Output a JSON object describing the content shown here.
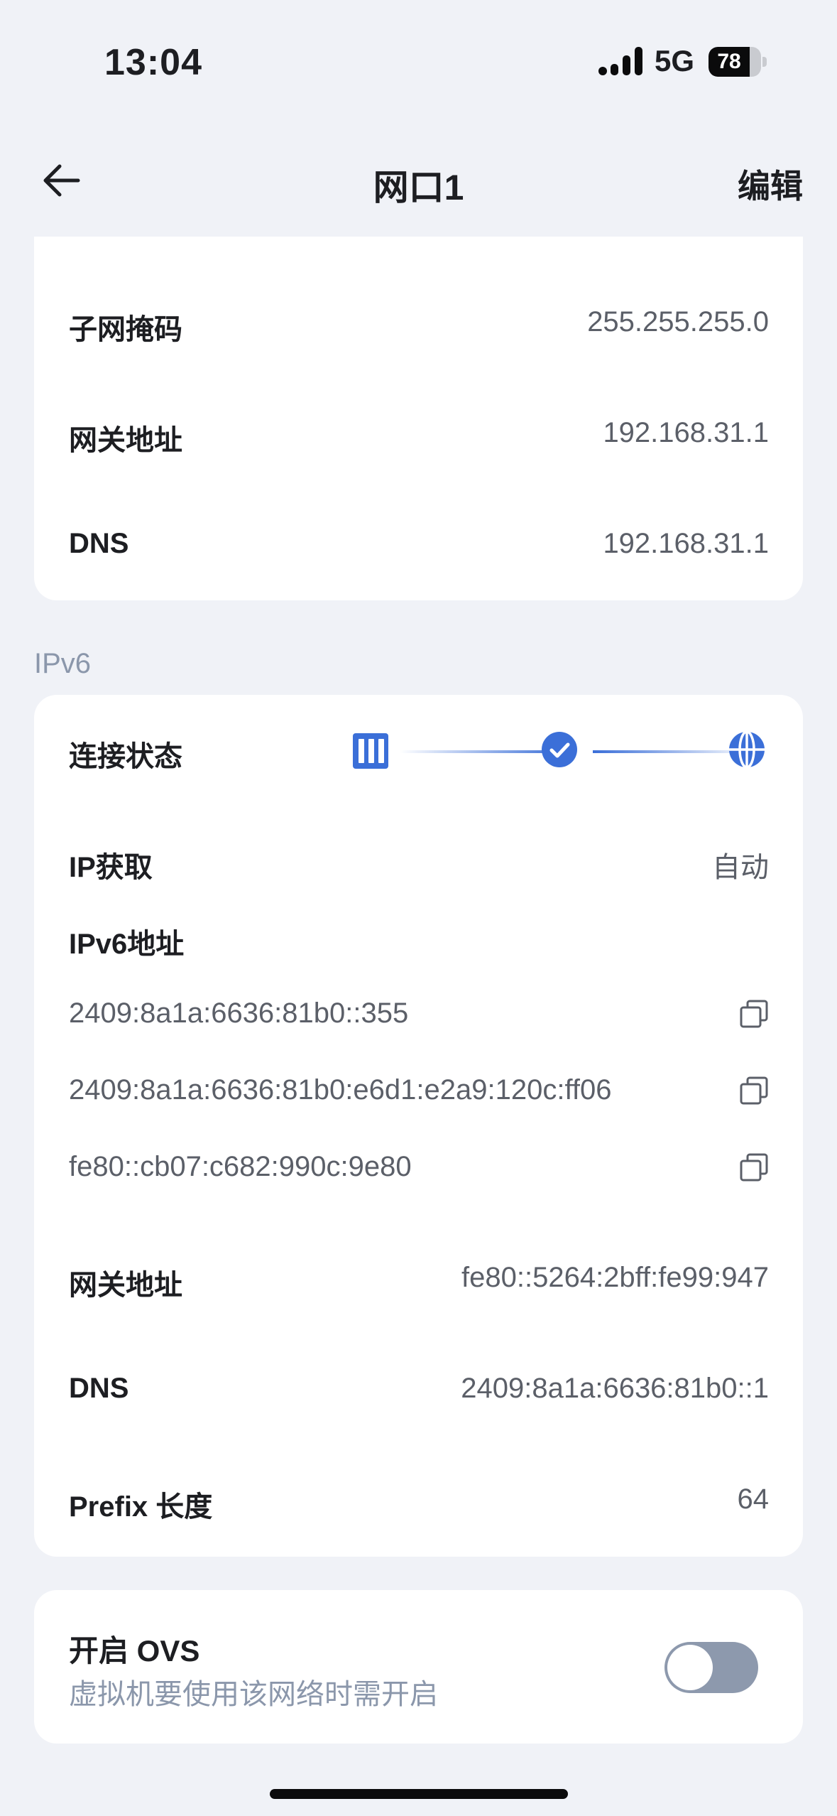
{
  "status_bar": {
    "time": "13:04",
    "network": "5G",
    "battery": "78",
    "battery_level": 0.78
  },
  "nav": {
    "title": "网口1",
    "edit_label": "编辑",
    "back_icon": "back-arrow-icon"
  },
  "ipv4": {
    "rows": [
      {
        "label": "子网掩码",
        "value": "255.255.255.0"
      },
      {
        "label": "网关地址",
        "value": "192.168.31.1"
      },
      {
        "label": "DNS",
        "value": "192.168.31.1"
      }
    ]
  },
  "ipv6": {
    "section_label": "IPv6",
    "status_label": "连接状态",
    "status_icons": [
      "device-icon",
      "check-icon",
      "globe-icon"
    ],
    "ip_mode_label": "IP获取",
    "ip_mode_value": "自动",
    "address_label": "IPv6地址",
    "addresses": [
      "2409:8a1a:6636:81b0::355",
      "2409:8a1a:6636:81b0:e6d1:e2a9:120c:ff06",
      "fe80::cb07:c682:990c:9e80"
    ],
    "gateway_label": "网关地址",
    "gateway_value": "fe80::5264:2bff:fe99:947",
    "dns_label": "DNS",
    "dns_value": "2409:8a1a:6636:81b0::1",
    "prefix_label": "Prefix 长度",
    "prefix_value": "64"
  },
  "ovs": {
    "title": "开启 OVS",
    "subtitle": "虚拟机要使用该网络时需开启",
    "enabled": false
  },
  "colors": {
    "accent": "#3b6fd8",
    "background": "#f0f2f7",
    "muted": "#8b97ab"
  }
}
